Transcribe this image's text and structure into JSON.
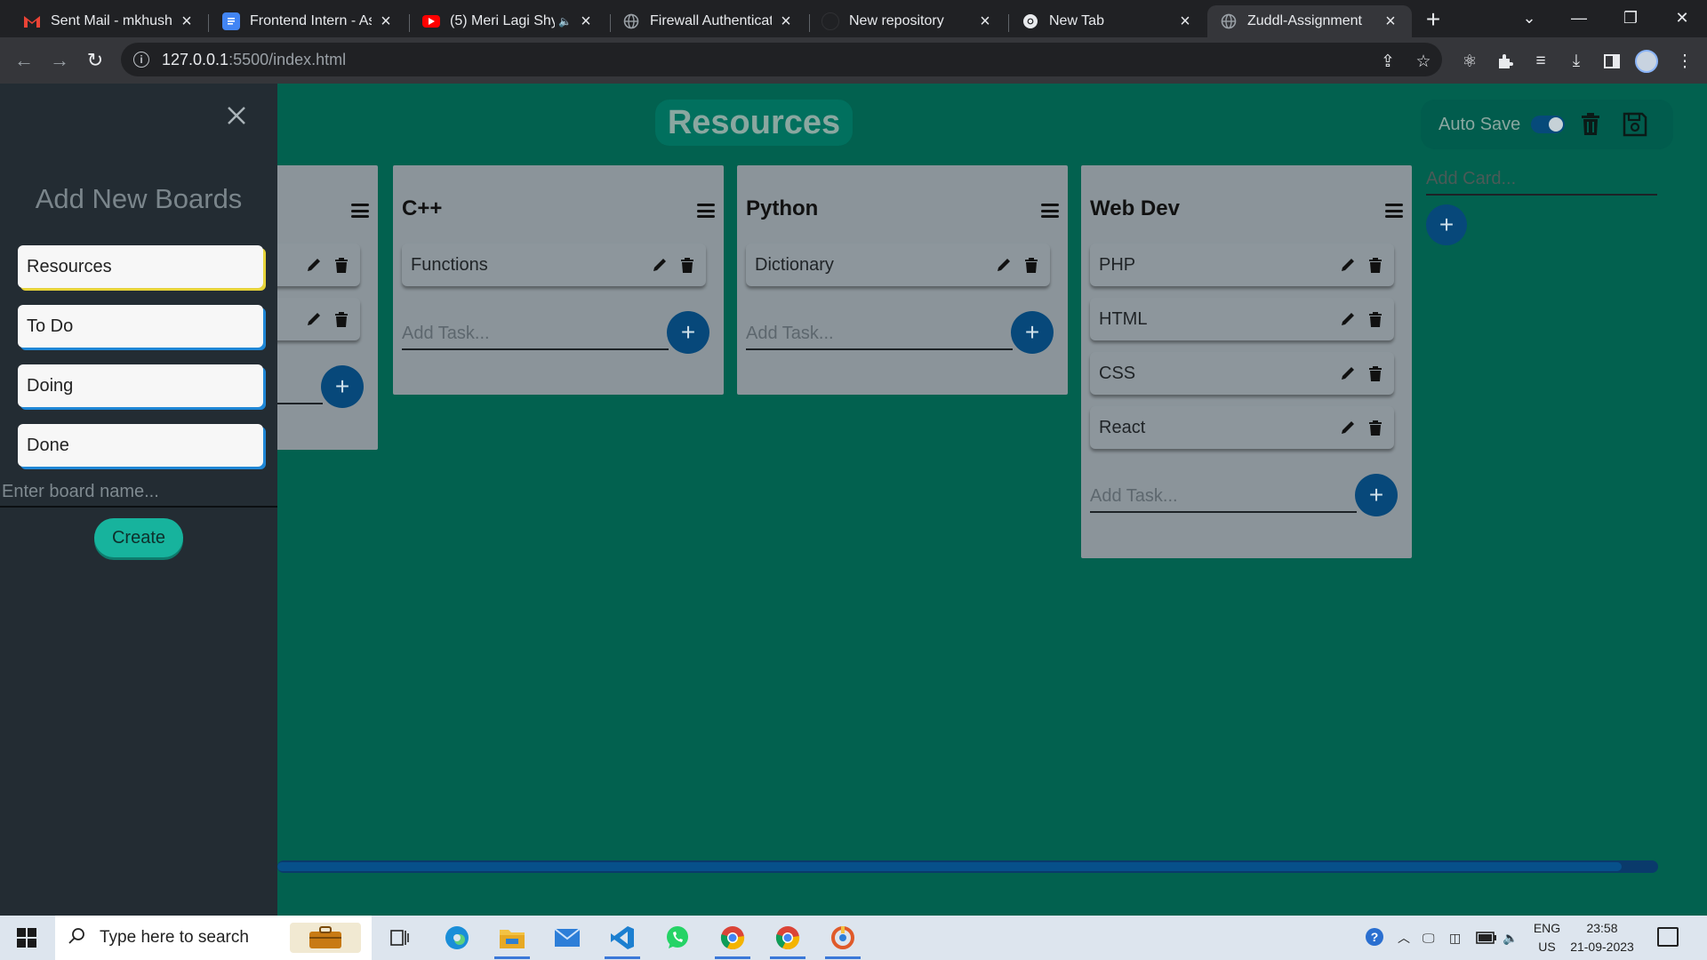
{
  "browser": {
    "tabs": [
      {
        "title": "Sent Mail - mkhushir",
        "icon": "gmail-icon",
        "color": "#ea4335"
      },
      {
        "title": "Frontend Intern - Ass",
        "icon": "docs-icon",
        "color": "#4285f4"
      },
      {
        "title": "(5) Meri Lagi Shy",
        "icon": "youtube-icon",
        "color": "#ff0000",
        "audio": "speaker-icon"
      },
      {
        "title": "Firewall Authenticatio",
        "icon": "globe-icon",
        "color": "#9aa0a6"
      },
      {
        "title": "New repository",
        "icon": "github-icon",
        "color": "#202124"
      },
      {
        "title": "New Tab",
        "icon": "chrome-icon",
        "color": "#e8eaed"
      },
      {
        "title": "Zuddl-Assignment",
        "icon": "globe-icon",
        "color": "#9aa0a6",
        "active": true
      }
    ],
    "url_host": "127.0.0.1",
    "url_path": ":5500/index.html"
  },
  "app": {
    "board_title": "Resources",
    "autosave_label": "Auto Save",
    "autosave_on": true,
    "add_card_placeholder": "Add Card...",
    "cards": [
      {
        "title": "",
        "tasks": [
          "",
          ""
        ]
      },
      {
        "title": "C++",
        "tasks": [
          "Functions"
        ],
        "add_placeholder": "Add Task..."
      },
      {
        "title": "Python",
        "tasks": [
          "Dictionary"
        ],
        "add_placeholder": "Add Task..."
      },
      {
        "title": "Web Dev",
        "tasks": [
          "PHP",
          "HTML",
          "CSS",
          "React"
        ],
        "add_placeholder": "Add Task..."
      }
    ]
  },
  "sidebar": {
    "title": "Add New Boards",
    "boards": [
      "Resources",
      "To Do",
      "Doing",
      "Done"
    ],
    "input_placeholder": "Enter board name...",
    "create_label": "Create"
  },
  "taskbar": {
    "search_placeholder": "Type here to search",
    "lang_top": "ENG",
    "lang_bottom": "US",
    "time": "23:58",
    "date": "21-09-2023"
  },
  "colors": {
    "board_bg": "#02614f",
    "card_bg": "#8b949a",
    "sidebar_bg": "#232c33",
    "accent_blue": "#07487a",
    "create_green": "#17b39d"
  }
}
